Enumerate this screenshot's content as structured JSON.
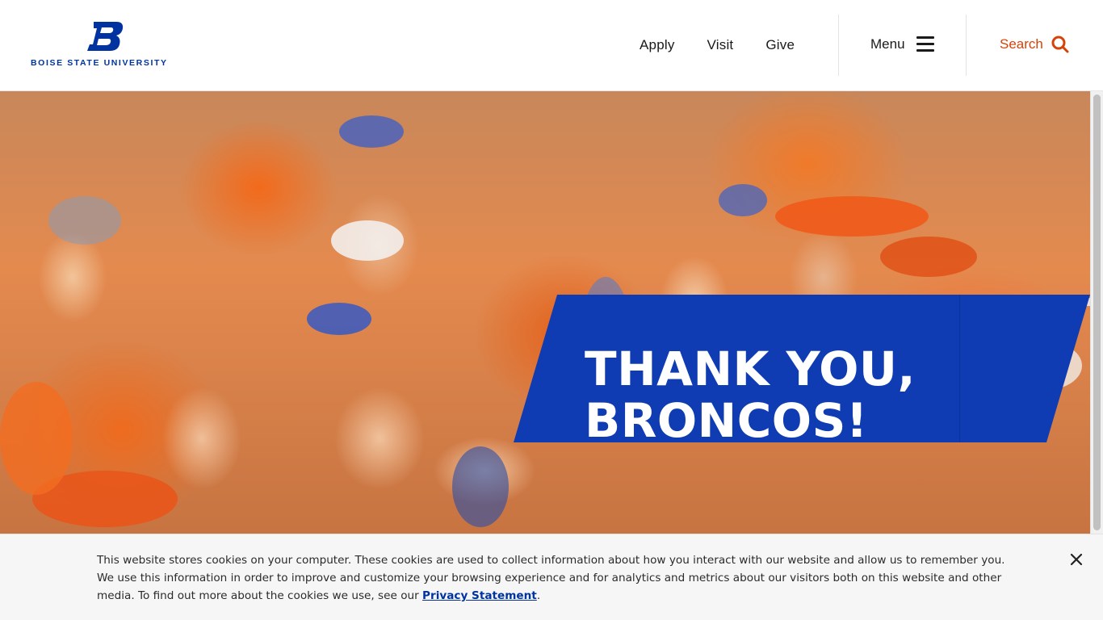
{
  "brand": {
    "logo_letter": "B",
    "name": "BOISE STATE UNIVERSITY",
    "primary_color": "#0033a0",
    "accent_color": "#d64309"
  },
  "header": {
    "nav": [
      {
        "label": "Apply"
      },
      {
        "label": "Visit"
      },
      {
        "label": "Give"
      }
    ],
    "menu_label": "Menu",
    "menu_icon": "hamburger-icon",
    "search_label": "Search",
    "search_icon": "search-icon"
  },
  "hero": {
    "image_alt": "crowd of cheering fans in orange",
    "banner_line1": "THANK YOU,",
    "banner_line2": "BRONCOS!"
  },
  "cookie_notice": {
    "text": "This website stores cookies on your computer. These cookies are used to collect information about how you interact with our website and allow us to remember you. We use this information in order to improve and customize your browsing experience and for analytics and metrics about our visitors both on this website and other media. To find out more about the cookies we use, see our ",
    "link_label": "Privacy Statement",
    "trailing": ".",
    "close_icon": "close-icon"
  }
}
